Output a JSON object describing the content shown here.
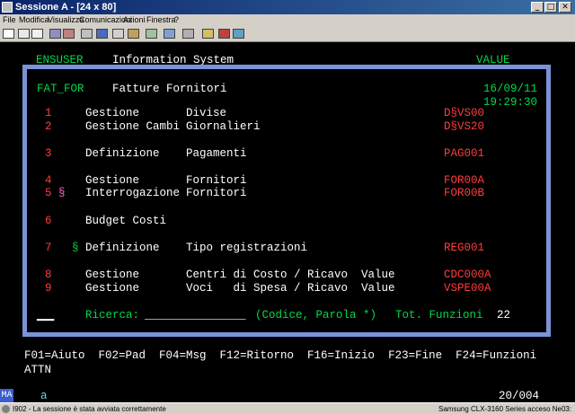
{
  "window": {
    "title": "Sessione A - [24 x 80]",
    "buttons": {
      "minimize": "_",
      "maximize": "□",
      "close": "✕"
    }
  },
  "menu": [
    "File",
    "Modifica",
    "Visualizza",
    "Comunicazioni",
    "Azioni",
    "Finestra",
    "?"
  ],
  "screen": {
    "header_left": "ENSUSER",
    "header_center": "Information System",
    "header_right": "VALUE",
    "program": "FAT_FOR",
    "program_title": "Fatture Fornitori",
    "date": "16/09/11",
    "time": "19:29:30",
    "functions": [
      {
        "num": "1",
        "mark": "",
        "action": "Gestione",
        "object": "Divise",
        "code": "D§VS00"
      },
      {
        "num": "2",
        "mark": "",
        "action": "Gestione Cambi",
        "object": "Giornalieri",
        "code": "D§VS20"
      },
      {
        "num": "3",
        "mark": "",
        "action": "Definizione",
        "object": "Pagamenti",
        "code": "PAG001"
      },
      {
        "num": "4",
        "mark": "",
        "action": "Gestione",
        "object": "Fornitori",
        "code": "FOR00A"
      },
      {
        "num": "5",
        "mark": "§",
        "action": "Interrogazione",
        "object": "Fornitori",
        "code": "FOR00B"
      },
      {
        "num": "6",
        "mark": "",
        "action": "Budget Costi",
        "object": "",
        "code": ""
      },
      {
        "num": "7",
        "mark": "§",
        "action": "Definizione",
        "object": "Tipo registrazioni",
        "code": "REG001"
      },
      {
        "num": "8",
        "mark": "",
        "action": "Gestione",
        "object": "Centri di Costo / Ricavo  Value",
        "code": "CDC000A"
      },
      {
        "num": "9",
        "mark": "",
        "action": "Gestione",
        "object": "Voci   di Spesa / Ricavo  Value",
        "code": "VSPE00A"
      }
    ],
    "search_label": "Ricerca:",
    "search_value": "_______________",
    "search_hint": "(Codice, Parola *)",
    "total_label": "Tot. Funzioni",
    "total_value": "22",
    "cursor": "▁▁",
    "fkeys": "F01=Aiuto  F02=Pad  F04=Msg  F12=Ritorno  F16=Inizio  F23=Fine  F24=Funzioni",
    "attn": "ATTN"
  },
  "oia": {
    "indicator": "MA",
    "input_mode": "a",
    "cursor_pos": "20/004"
  },
  "statusbar": {
    "message": "I902 - La sessione è stata avviata correttamente",
    "printer": "Samsung CLX-3160 Series acceso Ne03:"
  },
  "colors": {
    "panel_border": "#7a92d8",
    "terminal_green": "#00d84a",
    "terminal_red": "#ff3c3c",
    "terminal_pink": "#ff66cc"
  }
}
